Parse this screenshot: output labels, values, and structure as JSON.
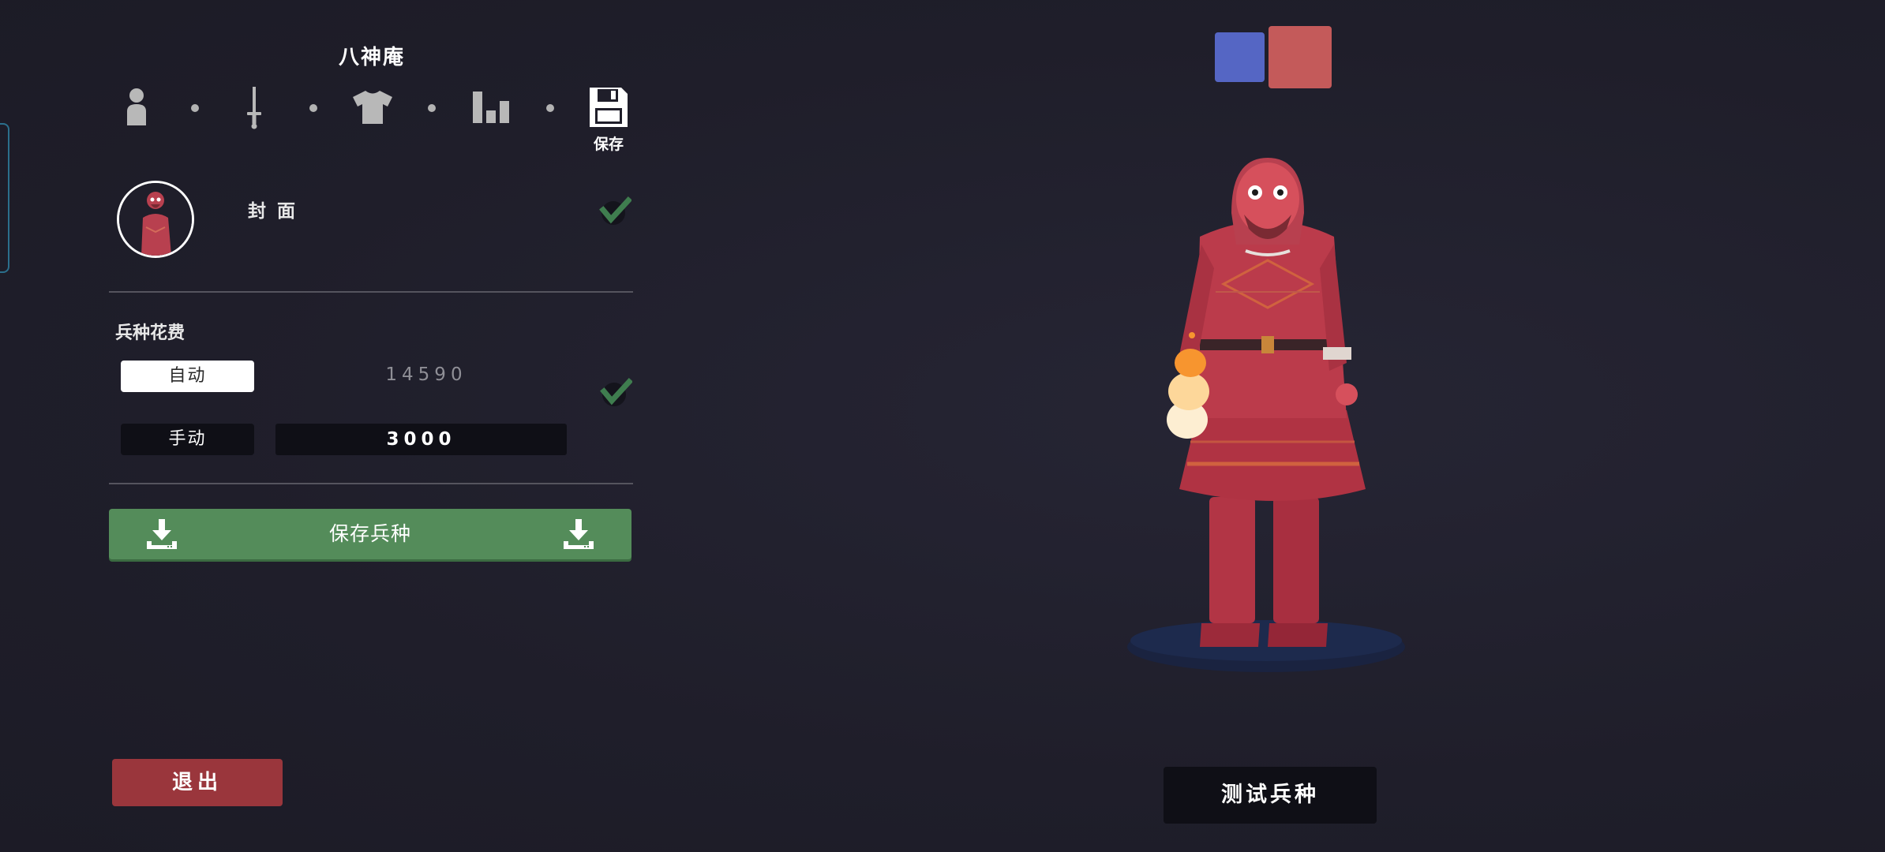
{
  "unit_name": "八神庵",
  "toolbar": {
    "steps": [
      {
        "icon": "person-icon"
      },
      {
        "icon": "sword-icon"
      },
      {
        "icon": "shirt-icon"
      },
      {
        "icon": "stats-icon"
      },
      {
        "icon": "floppy-disk-icon",
        "label": "保存"
      }
    ]
  },
  "cover": {
    "label": "封 面",
    "checked": true
  },
  "cost": {
    "section_label": "兵种花费",
    "auto_label": "自动",
    "auto_value": "14590",
    "manual_label": "手动",
    "manual_value": "3000",
    "auto_checked": true
  },
  "save_unit_label": "保存兵种",
  "exit_label": "退出",
  "test_unit_label": "测试兵种",
  "team_swatches": [
    {
      "name": "blue-team",
      "color": "#5566c4",
      "selected": false
    },
    {
      "name": "red-team",
      "color": "#c45a5a",
      "selected": true
    }
  ],
  "colors": {
    "background": "#1f1e2a",
    "accent_green": "#548c5a",
    "accent_red": "#9a363c",
    "unit_red": "#b83a4a"
  }
}
